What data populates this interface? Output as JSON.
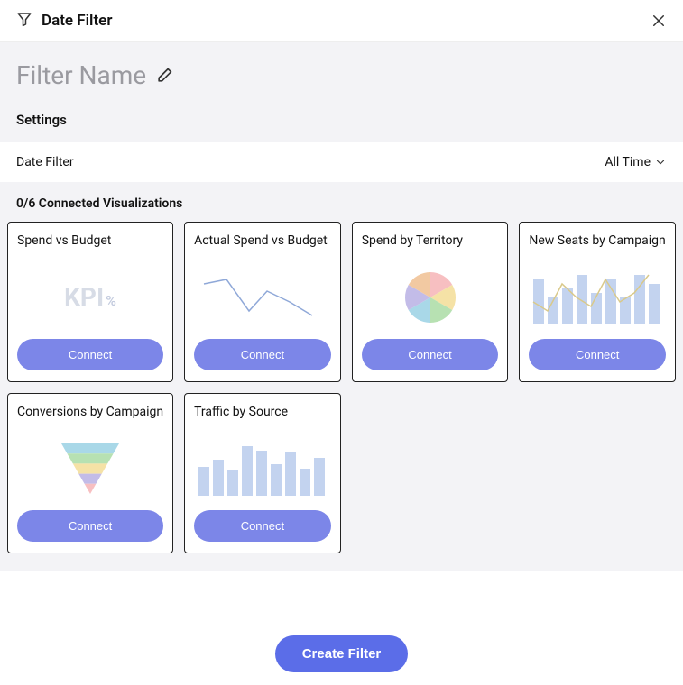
{
  "header": {
    "title": "Date Filter"
  },
  "filter_name_placeholder": "Filter Name",
  "settings_label": "Settings",
  "date_filter": {
    "label": "Date Filter",
    "value": "All Time"
  },
  "connected": {
    "header": "0/6 Connected Visualizations",
    "connect_label": "Connect"
  },
  "cards": [
    {
      "title": "Spend vs Budget",
      "preview": "kpi"
    },
    {
      "title": "Actual Spend vs Budget",
      "preview": "line"
    },
    {
      "title": "Spend by Territory",
      "preview": "pie"
    },
    {
      "title": "New Seats by Campaign",
      "preview": "barline"
    },
    {
      "title": "Conversions by Campaign",
      "preview": "funnel"
    },
    {
      "title": "Traffic by Source",
      "preview": "bar"
    }
  ],
  "footer": {
    "create_label": "Create Filter"
  }
}
